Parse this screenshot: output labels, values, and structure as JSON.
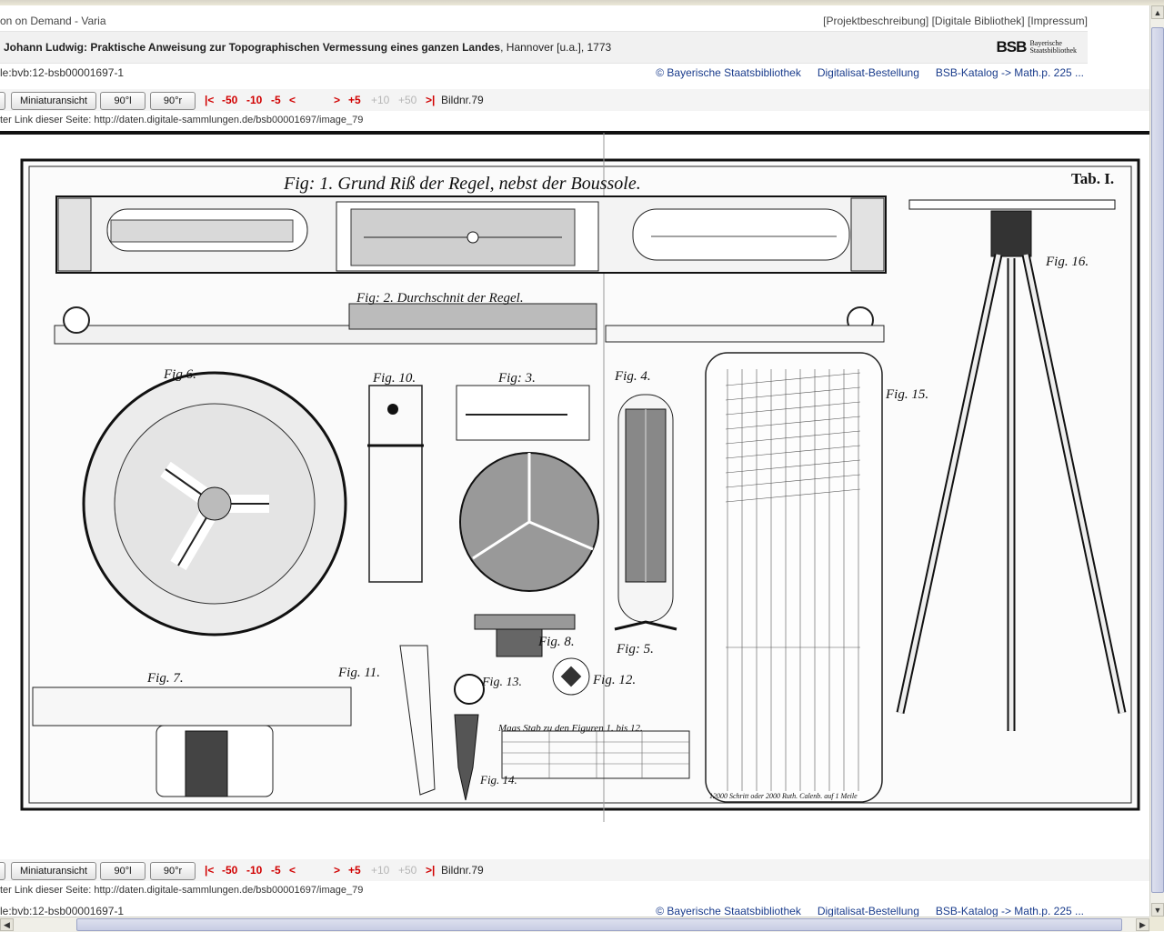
{
  "header": {
    "left_text": "on on Demand - Varia",
    "right_links": [
      "[Projektbeschreibung]",
      "[Digitale Bibliothek]",
      "[Impressum]"
    ]
  },
  "title": {
    "author_title": "Johann Ludwig: Praktische Anweisung zur Topographischen Vermessung eines ganzen Landes",
    "imprint": ", Hannover [u.a.], 1773"
  },
  "logo": {
    "mark": "BSB",
    "line1": "Bayerische",
    "line2": "Staatsbibliothek"
  },
  "info": {
    "urn": "le:bvb:12-bsb00001697-1",
    "links": [
      "© Bayerische Staatsbibliothek",
      "Digitalisat-Bestellung",
      "BSB-Katalog -> Math.p. 225 ..."
    ]
  },
  "nav": {
    "thumbnail_button": "Miniaturansicht",
    "rotate_left": "90°l",
    "rotate_right": "90°r",
    "first": "|<",
    "back50": "-50",
    "back10": "-10",
    "back5": "-5",
    "prev": "<",
    "next": ">",
    "fwd5": "+5",
    "fwd10": "+10",
    "fwd50": "+50",
    "last": ">|",
    "image_number": "Bildnr.79"
  },
  "permalink": {
    "label": "ter Link dieser Seite:",
    "url": "http://daten.digitale-sammlungen.de/bsb00001697/image_79"
  },
  "plate": {
    "fig1": "Fig: 1. Grund Riß der Regel, nebst der Boussole.",
    "fig2": "Fig: 2. Durchschnit der Regel.",
    "tab": "Tab. I.",
    "fig3": "Fig: 3.",
    "fig4": "Fig. 4.",
    "fig5": "Fig: 5.",
    "fig6": "Fig 6.",
    "fig7": "Fig. 7.",
    "fig8": "Fig. 8.",
    "fig10": "Fig. 10.",
    "fig11": "Fig. 11.",
    "fig12": "Fig. 12.",
    "fig13": "Fig. 13.",
    "fig14": "Fig. 14.",
    "fig15": "Fig. 15.",
    "fig16": "Fig. 16.",
    "scale_label": "Maas Stab zu den Figuren 1. bis 12.",
    "scale_bottom": "12000 Schritt oder 2000 Ruth. Calenb. auf 1 Meile"
  },
  "colors": {
    "link": "#1a3c8c",
    "nav_red": "#d10000",
    "nav_gray": "#b6b6b6"
  }
}
